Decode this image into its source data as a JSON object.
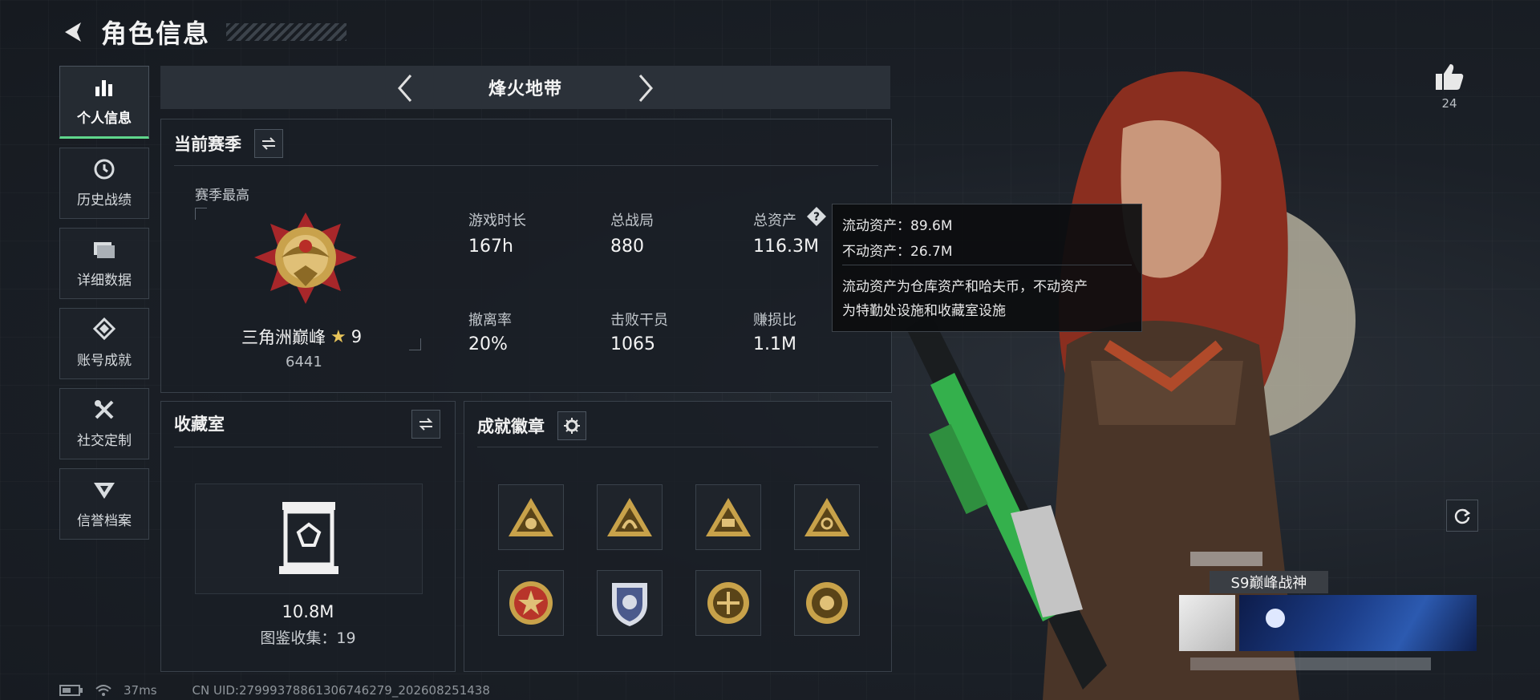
{
  "header": {
    "title": "角色信息"
  },
  "sidebar": {
    "items": [
      {
        "label": "个人信息",
        "icon": "bar-chart-icon",
        "active": true
      },
      {
        "label": "历史战绩",
        "icon": "history-clock-icon"
      },
      {
        "label": "详细数据",
        "icon": "folder-icon"
      },
      {
        "label": "账号成就",
        "icon": "diamond-medal-icon"
      },
      {
        "label": "社交定制",
        "icon": "tools-icon"
      },
      {
        "label": "信誉档案",
        "icon": "shield-wing-icon"
      }
    ]
  },
  "mode": {
    "title": "烽火地带"
  },
  "season": {
    "title": "当前赛季",
    "best_label": "赛季最高",
    "rank_name": "三角洲巅峰",
    "star_level": "9",
    "rank_score": "6441",
    "stats": [
      {
        "label": "游戏时长",
        "value": "167h"
      },
      {
        "label": "总战局",
        "value": "880"
      },
      {
        "label": "总资产",
        "value": "116.3M"
      },
      {
        "label": "撤离率",
        "value": "20%"
      },
      {
        "label": "击败干员",
        "value": "1065"
      },
      {
        "label": "赚损比",
        "value": "1.1M"
      }
    ]
  },
  "tooltip": {
    "liquid": "流动资产：89.6M",
    "fixed": "不动资产：26.7M",
    "desc_line1": "流动资产为仓库资产和哈夫币，不动资产",
    "desc_line2": "为特勤处设施和收藏室设施"
  },
  "collection": {
    "title": "收藏室",
    "value": "10.8M",
    "count_text": "图鉴收集：19"
  },
  "achievements": {
    "title": "成就徽章",
    "badges": [
      {
        "icon": "gold-triangle-badge-icon",
        "color": "#c8a24a"
      },
      {
        "icon": "gold-triangle-badge-icon",
        "color": "#c8a24a"
      },
      {
        "icon": "gold-triangle-badge-icon",
        "color": "#c8a24a"
      },
      {
        "icon": "gold-triangle-badge-icon",
        "color": "#c8a24a"
      },
      {
        "icon": "red-star-round-badge-icon",
        "color": "#b8352a"
      },
      {
        "icon": "blue-shield-badge-icon",
        "color": "#4b5a8c"
      },
      {
        "icon": "gold-round-badge-icon",
        "color": "#c8a24a"
      },
      {
        "icon": "gold-round-badge-icon",
        "color": "#c8a24a"
      }
    ]
  },
  "profile": {
    "likes": "24",
    "title_tag": "S9巅峰战神"
  },
  "status": {
    "ping": "37ms",
    "uid": "CN UID:27999378861306746279_202608251438"
  },
  "colors": {
    "accent": "#5fd68c",
    "gold": "#c8a24a"
  }
}
